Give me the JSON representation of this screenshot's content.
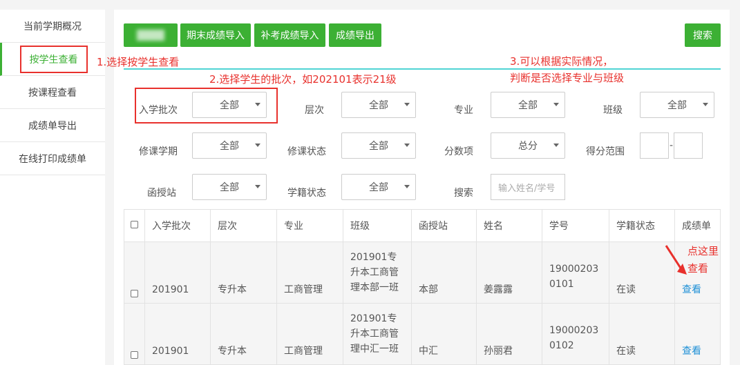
{
  "sidebar": {
    "items": [
      {
        "label": "当前学期概况"
      },
      {
        "label": "按学生查看"
      },
      {
        "label": "按课程查看"
      },
      {
        "label": "成绩单导出"
      },
      {
        "label": "在线打印成绩单"
      }
    ]
  },
  "toolbar": {
    "final_import": "期末成绩导入",
    "makeup_import": "补考成绩导入",
    "export": "成绩导出",
    "search": "搜索"
  },
  "filters": {
    "batch": {
      "label": "入学批次",
      "value": "全部"
    },
    "level": {
      "label": "层次",
      "value": "全部"
    },
    "major": {
      "label": "专业",
      "value": "全部"
    },
    "class": {
      "label": "班级",
      "value": "全部"
    },
    "term": {
      "label": "修课学期",
      "value": "全部"
    },
    "course_status": {
      "label": "修课状态",
      "value": "全部"
    },
    "score_item": {
      "label": "分数项",
      "value": "总分"
    },
    "score_range": {
      "label": "得分范围",
      "separator": "-"
    },
    "station": {
      "label": "函授站",
      "value": "全部"
    },
    "enroll_status": {
      "label": "学籍状态",
      "value": "全部"
    },
    "search": {
      "label": "搜索",
      "placeholder": "输入姓名/学号"
    }
  },
  "table": {
    "headers": [
      "入学批次",
      "层次",
      "专业",
      "班级",
      "函授站",
      "姓名",
      "学号",
      "学籍状态",
      "成绩单"
    ],
    "rows": [
      {
        "batch": "201901",
        "level": "专升本",
        "major": "工商管理",
        "class": "201901专升本工商管理本部一班",
        "station": "本部",
        "name": "姜露露",
        "id": "190002030101",
        "status": "在读",
        "action": "查看"
      },
      {
        "batch": "201901",
        "level": "专升本",
        "major": "工商管理",
        "class": "201901专升本工商管理中汇一班",
        "station": "中汇",
        "name": "孙丽君",
        "id": "190002030102",
        "status": "在读",
        "action": "查看"
      }
    ]
  },
  "annotations": {
    "step1": "1.选择按学生查看",
    "step2": "2.选择学生的批次，如202101表示21级",
    "step3_line1": "3.可以根据实际情况，",
    "step3_line2": "判断是否选择专业与班级",
    "click_line1": "点这里",
    "click_line2": "查看"
  },
  "colors": {
    "accent": "#3cb034",
    "annotation": "#e8302c",
    "link": "#1e90d6"
  }
}
